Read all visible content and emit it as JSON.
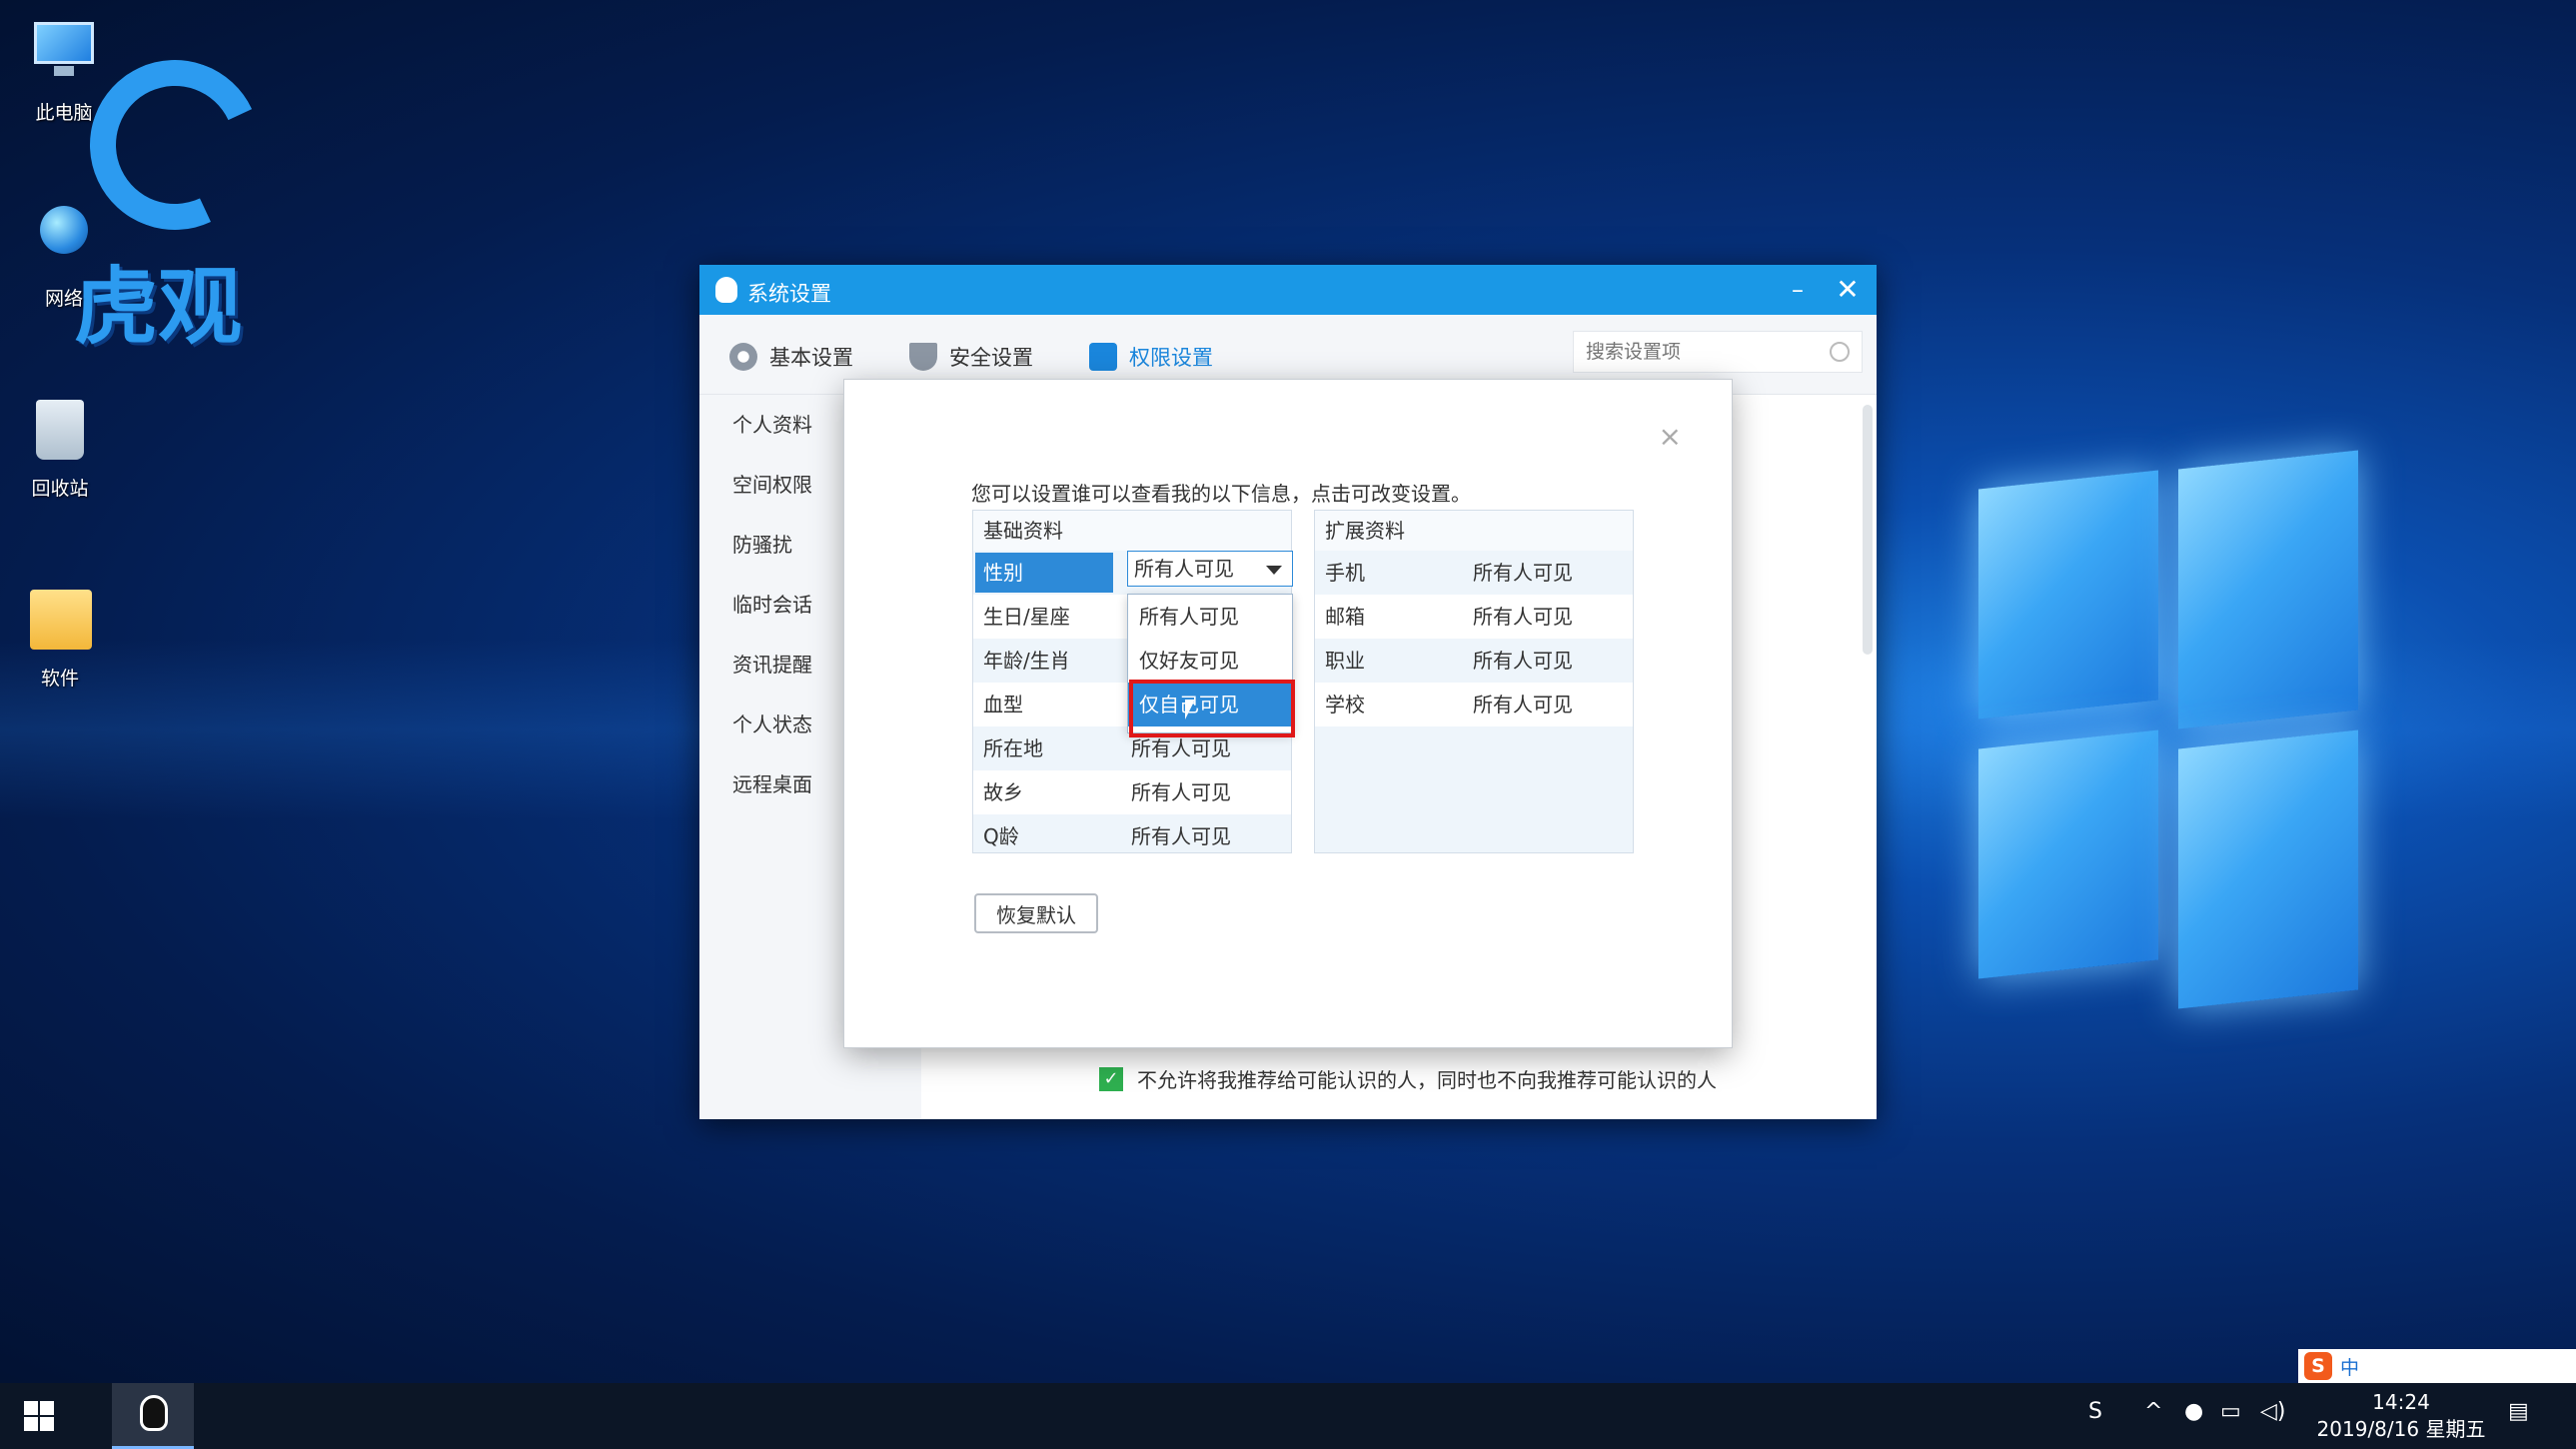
{
  "desktop": {
    "icons": [
      {
        "label": "此电脑",
        "icon": "computer-icon"
      },
      {
        "label": "网络",
        "icon": "network-icon"
      },
      {
        "label": "回收站",
        "icon": "recycle-bin-icon"
      },
      {
        "label": "软件",
        "icon": "folder-icon"
      }
    ],
    "brand": "虎观"
  },
  "window": {
    "title": "系统设置",
    "minimize": "–",
    "close": "✕",
    "tabs": [
      {
        "label": "基本设置",
        "icon": "gear-icon"
      },
      {
        "label": "安全设置",
        "icon": "shield-icon"
      },
      {
        "label": "权限设置",
        "icon": "lock-icon",
        "active": true
      }
    ],
    "search_placeholder": "搜索设置项",
    "sidebar": [
      "个人资料",
      "空间权限",
      "防骚扰",
      "临时会话",
      "资讯提醒",
      "个人状态",
      "远程桌面"
    ],
    "bottom_option": "不允许将我推荐给可能认识的人，同时也不向我推荐可能认识的人"
  },
  "modal": {
    "close": "×",
    "description": "您可以设置谁可以查看我的以下信息，点击可改变设置。",
    "basic": {
      "header": "基础资料",
      "rows": [
        {
          "label": "性别",
          "value": "所有人可见"
        },
        {
          "label": "生日/星座",
          "value": ""
        },
        {
          "label": "年龄/生肖",
          "value": ""
        },
        {
          "label": "血型",
          "value": ""
        },
        {
          "label": "所在地",
          "value": "所有人可见"
        },
        {
          "label": "故乡",
          "value": "所有人可见"
        },
        {
          "label": "Q龄",
          "value": "所有人可见"
        }
      ]
    },
    "extended": {
      "header": "扩展资料",
      "rows": [
        {
          "label": "手机",
          "value": "所有人可见"
        },
        {
          "label": "邮箱",
          "value": "所有人可见"
        },
        {
          "label": "职业",
          "value": "所有人可见"
        },
        {
          "label": "学校",
          "value": "所有人可见"
        }
      ]
    },
    "dropdown": {
      "selected": "所有人可见",
      "options": [
        "所有人可见",
        "仅好友可见",
        "仅自己可见"
      ],
      "highlighted_index": 2
    },
    "restore_button": "恢复默认"
  },
  "taskbar": {
    "ime": "中",
    "time": "14:24",
    "date": "2019/8/16 星期五"
  },
  "colors": {
    "accent": "#1a98e6",
    "selection": "#2d8ad8",
    "highlight_box": "#e01818"
  }
}
